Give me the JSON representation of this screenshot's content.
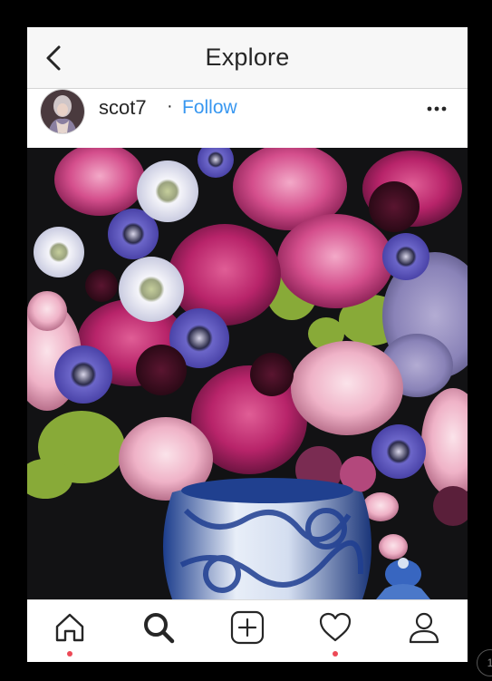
{
  "header": {
    "title": "Explore",
    "back_icon": "chevron-left-icon"
  },
  "post": {
    "username": "scot7",
    "separator": "·",
    "follow_label": "Follow",
    "more_icon": "more-horizontal-icon",
    "image": "Bouquet of pink peonies, purple scabiosa, hydrangea and lady's mantle in a blue-and-white porcelain vase"
  },
  "tabbar": {
    "items": [
      {
        "icon": "home-icon",
        "has_notification": true
      },
      {
        "icon": "search-icon",
        "active": true
      },
      {
        "icon": "add-post-icon"
      },
      {
        "icon": "heart-icon",
        "has_notification": true
      },
      {
        "icon": "profile-icon"
      }
    ]
  },
  "colors": {
    "accent": "#3897f0",
    "notification": "#ed4956",
    "text": "#262626",
    "header_bg": "#f7f7f7",
    "frame_bg": "#000000"
  },
  "corner_badge": "1"
}
